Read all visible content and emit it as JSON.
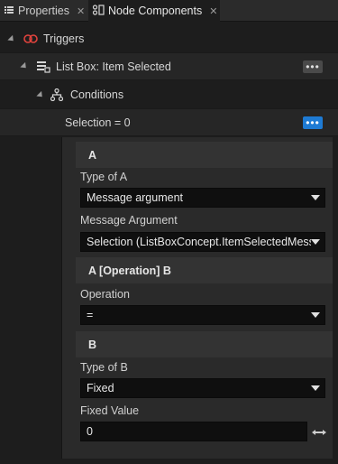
{
  "tabs": [
    {
      "label": "Properties",
      "icon": "properties-list-icon"
    },
    {
      "label": "Node Components",
      "icon": "node-components-icon"
    }
  ],
  "tree": {
    "triggers_label": "Triggers",
    "trigger_item_label": "List Box: Item Selected",
    "conditions_label": "Conditions",
    "condition_label": "Selection = 0",
    "more_label": "•••"
  },
  "editor": {
    "section_a": "A",
    "type_of_a_label": "Type of A",
    "type_of_a_value": "Message argument",
    "message_argument_label": "Message Argument",
    "message_argument_value": "Selection (ListBoxConcept.ItemSelectedMessa",
    "section_op": "A [Operation] B",
    "operation_label": "Operation",
    "operation_value": "=",
    "section_b": "B",
    "type_of_b_label": "Type of B",
    "type_of_b_value": "Fixed",
    "fixed_value_label": "Fixed Value",
    "fixed_value_value": "0"
  },
  "colors": {
    "accent": "#1e7bd4",
    "triggers_icon": "#e0433d",
    "background": "#1d1d1d"
  }
}
